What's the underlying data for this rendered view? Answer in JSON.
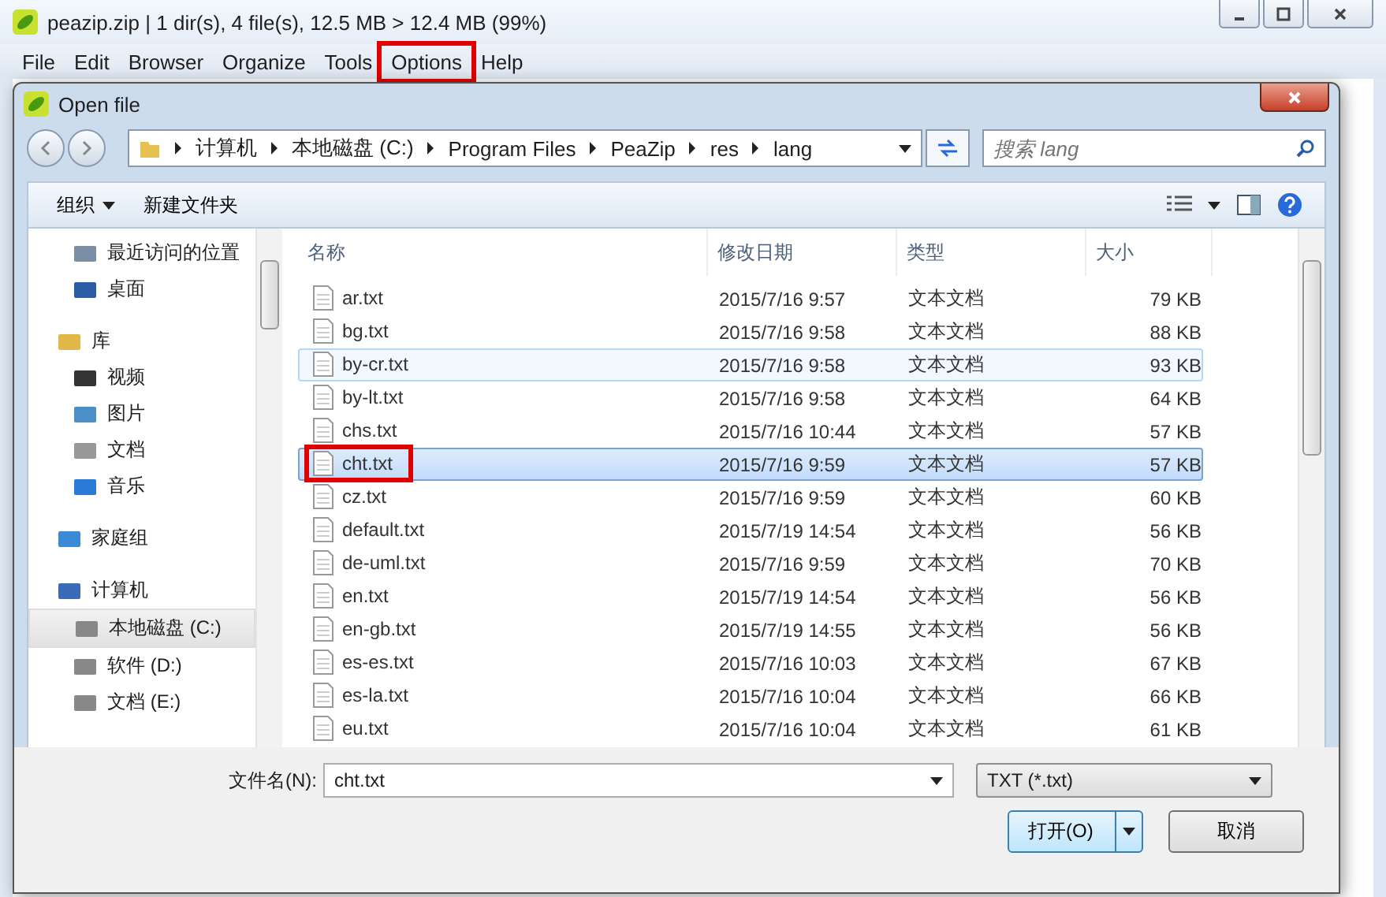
{
  "window": {
    "title": "peazip.zip | 1 dir(s), 4 file(s), 12.5 MB > 12.4 MB (99%)"
  },
  "menu": [
    {
      "label": "File",
      "highlighted": false
    },
    {
      "label": "Edit",
      "highlighted": false
    },
    {
      "label": "Browser",
      "highlighted": false
    },
    {
      "label": "Organize",
      "highlighted": false
    },
    {
      "label": "Tools",
      "highlighted": false
    },
    {
      "label": "Options",
      "highlighted": true
    },
    {
      "label": "Help",
      "highlighted": false
    }
  ],
  "dialog": {
    "title": "Open file",
    "breadcrumb": [
      "计算机",
      "本地磁盘 (C:)",
      "Program Files",
      "PeaZip",
      "res",
      "lang"
    ],
    "search": {
      "placeholder": "搜索 lang"
    },
    "toolbar": {
      "organize": "组织",
      "new_folder": "新建文件夹"
    },
    "sidebar": [
      {
        "label": "最近访问的位置",
        "kind": "recent",
        "group": false,
        "selected": false
      },
      {
        "label": "桌面",
        "kind": "desktop",
        "group": false,
        "selected": false
      },
      {
        "label": "库",
        "kind": "library",
        "group": true,
        "selected": false
      },
      {
        "label": "视频",
        "kind": "video",
        "group": false,
        "selected": false
      },
      {
        "label": "图片",
        "kind": "picture",
        "group": false,
        "selected": false
      },
      {
        "label": "文档",
        "kind": "document",
        "group": false,
        "selected": false
      },
      {
        "label": "音乐",
        "kind": "music",
        "group": false,
        "selected": false
      },
      {
        "label": "家庭组",
        "kind": "homegroup",
        "group": true,
        "selected": false
      },
      {
        "label": "计算机",
        "kind": "computer",
        "group": true,
        "selected": false
      },
      {
        "label": "本地磁盘 (C:)",
        "kind": "drive",
        "group": false,
        "selected": true
      },
      {
        "label": "软件 (D:)",
        "kind": "drive",
        "group": false,
        "selected": false
      },
      {
        "label": "文档 (E:)",
        "kind": "drive",
        "group": false,
        "selected": false
      }
    ],
    "columns": [
      "名称",
      "修改日期",
      "类型",
      "大小"
    ],
    "rows": [
      {
        "name": "ar.txt",
        "date": "2015/7/16 9:57",
        "type": "文本文档",
        "size": "79 KB",
        "selected": false,
        "hovered": false,
        "highlighted": false
      },
      {
        "name": "bg.txt",
        "date": "2015/7/16 9:58",
        "type": "文本文档",
        "size": "88 KB",
        "selected": false,
        "hovered": false,
        "highlighted": false
      },
      {
        "name": "by-cr.txt",
        "date": "2015/7/16 9:58",
        "type": "文本文档",
        "size": "93 KB",
        "selected": false,
        "hovered": true,
        "highlighted": false
      },
      {
        "name": "by-lt.txt",
        "date": "2015/7/16 9:58",
        "type": "文本文档",
        "size": "64 KB",
        "selected": false,
        "hovered": false,
        "highlighted": false
      },
      {
        "name": "chs.txt",
        "date": "2015/7/16 10:44",
        "type": "文本文档",
        "size": "57 KB",
        "selected": false,
        "hovered": false,
        "highlighted": false
      },
      {
        "name": "cht.txt",
        "date": "2015/7/16 9:59",
        "type": "文本文档",
        "size": "57 KB",
        "selected": true,
        "hovered": false,
        "highlighted": true
      },
      {
        "name": "cz.txt",
        "date": "2015/7/16 9:59",
        "type": "文本文档",
        "size": "60 KB",
        "selected": false,
        "hovered": false,
        "highlighted": false
      },
      {
        "name": "default.txt",
        "date": "2015/7/19 14:54",
        "type": "文本文档",
        "size": "56 KB",
        "selected": false,
        "hovered": false,
        "highlighted": false
      },
      {
        "name": "de-uml.txt",
        "date": "2015/7/16 9:59",
        "type": "文本文档",
        "size": "70 KB",
        "selected": false,
        "hovered": false,
        "highlighted": false
      },
      {
        "name": "en.txt",
        "date": "2015/7/19 14:54",
        "type": "文本文档",
        "size": "56 KB",
        "selected": false,
        "hovered": false,
        "highlighted": false
      },
      {
        "name": "en-gb.txt",
        "date": "2015/7/19 14:55",
        "type": "文本文档",
        "size": "56 KB",
        "selected": false,
        "hovered": false,
        "highlighted": false
      },
      {
        "name": "es-es.txt",
        "date": "2015/7/16 10:03",
        "type": "文本文档",
        "size": "67 KB",
        "selected": false,
        "hovered": false,
        "highlighted": false
      },
      {
        "name": "es-la.txt",
        "date": "2015/7/16 10:04",
        "type": "文本文档",
        "size": "66 KB",
        "selected": false,
        "hovered": false,
        "highlighted": false
      },
      {
        "name": "eu.txt",
        "date": "2015/7/16 10:04",
        "type": "文本文档",
        "size": "61 KB",
        "selected": false,
        "hovered": false,
        "highlighted": false
      }
    ],
    "filename_label": "文件名(N):",
    "filename": "cht.txt",
    "filter": "TXT (*.txt)",
    "open_button": "打开(O)",
    "cancel_button": "取消"
  }
}
